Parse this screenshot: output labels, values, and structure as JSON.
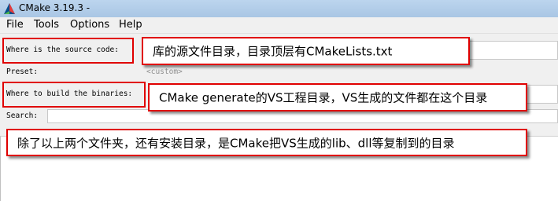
{
  "window": {
    "title": "CMake 3.19.3 -"
  },
  "menu": [
    "File",
    "Tools",
    "Options",
    "Help"
  ],
  "form": {
    "source_label": "Where is the source code:",
    "preset_label": "Preset:",
    "preset_value": "<custom>",
    "build_label": "Where to build the binaries:",
    "search_label": "Search:"
  },
  "annotations": {
    "source": "库的源文件目录，目录顶层有CMakeLists.txt",
    "build": "CMake generate的VS工程目录，VS生成的文件都在这个目录",
    "install": "除了以上两个文件夹，还有安装目录，是CMake把VS生成的lib、dll等复制到的目录"
  },
  "colors": {
    "annotation_border": "#e00000",
    "titlebar": "#bcd5ee"
  },
  "icons": {
    "app": "cmake-triangle-icon"
  }
}
